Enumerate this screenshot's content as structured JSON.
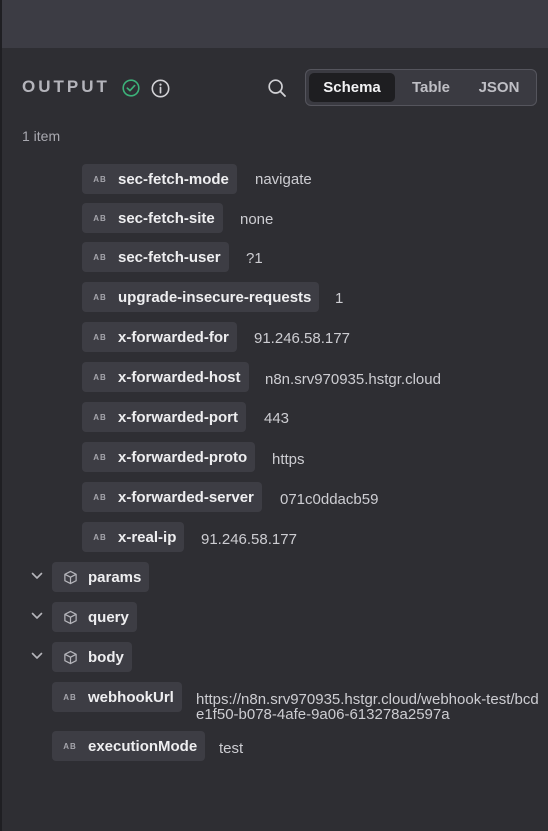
{
  "header": {
    "title": "OUTPUT",
    "tabs": [
      {
        "label": "Schema",
        "active": true
      },
      {
        "label": "Table",
        "active": false
      },
      {
        "label": "JSON",
        "active": false
      }
    ]
  },
  "count": "1 item",
  "type_badge": "AB",
  "fields": [
    {
      "key": "sec-fetch-mode",
      "value": "navigate"
    },
    {
      "key": "sec-fetch-site",
      "value": "none"
    },
    {
      "key": "sec-fetch-user",
      "value": "?1"
    },
    {
      "key": "upgrade-insecure-requests",
      "value": "1"
    },
    {
      "key": "x-forwarded-for",
      "value": "91.246.58.177"
    },
    {
      "key": "x-forwarded-host",
      "value": "n8n.srv970935.hstgr.cloud"
    },
    {
      "key": "x-forwarded-port",
      "value": "443"
    },
    {
      "key": "x-forwarded-proto",
      "value": "https"
    },
    {
      "key": "x-forwarded-server",
      "value": "071c0ddacb59"
    },
    {
      "key": "x-real-ip",
      "value": "91.246.58.177"
    }
  ],
  "objects": [
    {
      "key": "params"
    },
    {
      "key": "query"
    },
    {
      "key": "body"
    }
  ],
  "body_fields": [
    {
      "key": "webhookUrl",
      "value": "https://n8n.srv970935.hstgr.cloud/webhook-test/bcde1f50-b078-4afe-9a06-613278a2597a"
    },
    {
      "key": "executionMode",
      "value": "test"
    }
  ],
  "colors": {
    "success": "#3cb179",
    "active_tab": "#1e1e21"
  }
}
